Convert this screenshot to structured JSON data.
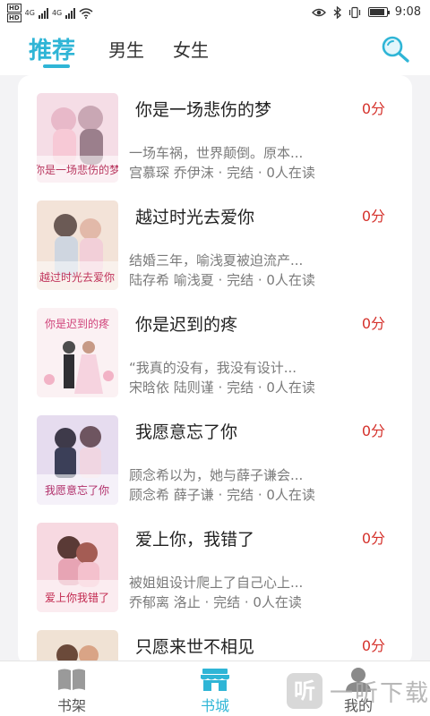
{
  "status_bar": {
    "time": "9:08",
    "network_1": "4G",
    "network_2": "4G",
    "sim_1": "HD",
    "sim_2": "HD"
  },
  "tabs": [
    {
      "label": "推荐",
      "active": true
    },
    {
      "label": "男生",
      "active": false
    },
    {
      "label": "女生",
      "active": false
    }
  ],
  "accent_color": "#2fb5d6",
  "score_color": "#d5322c",
  "books": [
    {
      "title": "你是一场悲伤的梦",
      "score": "0分",
      "desc": "一场车祸，世界颠倒。原本...",
      "meta": "宫慕琛 乔伊沫 · 完结 · 0人在读",
      "cover_text": "你是一场悲伤的梦"
    },
    {
      "title": "越过时光去爱你",
      "score": "0分",
      "desc": "结婚三年，喻浅夏被迫流产...",
      "meta": "陆存希 喻浅夏 · 完结 · 0人在读",
      "cover_text": "越过时光去爱你"
    },
    {
      "title": "你是迟到的疼",
      "score": "0分",
      "desc": "“我真的没有，我没有设计...",
      "meta": "宋晗依 陆则谨 · 完结 · 0人在读",
      "cover_text": "你是迟到的疼"
    },
    {
      "title": "我愿意忘了你",
      "score": "0分",
      "desc": "顾念希以为，她与薛子谦会...",
      "meta": "顾念希 薛子谦 · 完结 · 0人在读",
      "cover_text": "我愿意忘了你"
    },
    {
      "title": "爱上你，我错了",
      "score": "0分",
      "desc": "被姐姐设计爬上了自己心上...",
      "meta": "乔郁离 洛止 · 完结 · 0人在读",
      "cover_text": "爱上你我错了"
    },
    {
      "title": "只愿来世不相见",
      "score": "0分",
      "desc": "",
      "meta": "",
      "cover_text": ""
    }
  ],
  "bottom_nav": [
    {
      "label": "书架",
      "icon": "book-icon",
      "active": false
    },
    {
      "label": "书城",
      "icon": "store-icon",
      "active": true
    },
    {
      "label": "我的",
      "icon": "user-icon",
      "active": false
    }
  ],
  "watermark": {
    "logo": "听",
    "text": "一听下载"
  }
}
